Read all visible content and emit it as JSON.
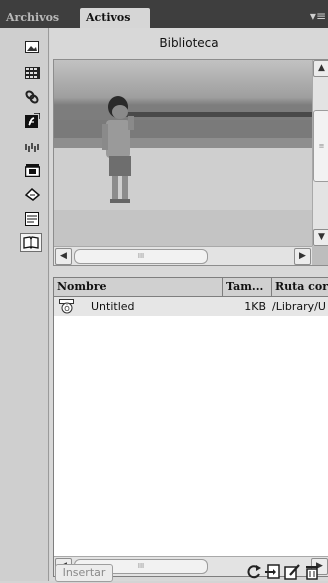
{
  "tabs": [
    {
      "label": "Archivos",
      "active": false
    },
    {
      "label": "Activos",
      "active": true
    }
  ],
  "panel_menu_icon": "panel-menu-icon",
  "categories": [
    {
      "icon": "image-icon",
      "selected": false
    },
    {
      "icon": "color-swatch-icon",
      "selected": false
    },
    {
      "icon": "link-icon",
      "selected": false
    },
    {
      "icon": "flash-icon",
      "selected": false
    },
    {
      "icon": "shockwave-icon",
      "selected": false
    },
    {
      "icon": "movie-icon",
      "selected": false
    },
    {
      "icon": "script-icon",
      "selected": false
    },
    {
      "icon": "template-icon",
      "selected": false
    },
    {
      "icon": "library-icon",
      "selected": true
    }
  ],
  "library": {
    "title": "Biblioteca"
  },
  "columns": {
    "name": "Nombre",
    "size": "Tam...",
    "path": "Ruta cor"
  },
  "rows": [
    {
      "icon": "library-item-icon",
      "name": "Untitled",
      "size": "1KB",
      "path": "/Library/U"
    }
  ],
  "bottom": {
    "insert_label": "Insertar",
    "icons": [
      "refresh-icon",
      "new-item-icon",
      "edit-icon",
      "delete-icon"
    ]
  },
  "colors": {
    "tabbar": "#3e3e3e",
    "panel": "#d8d8d8",
    "row_selected": "#e6e6e6"
  }
}
